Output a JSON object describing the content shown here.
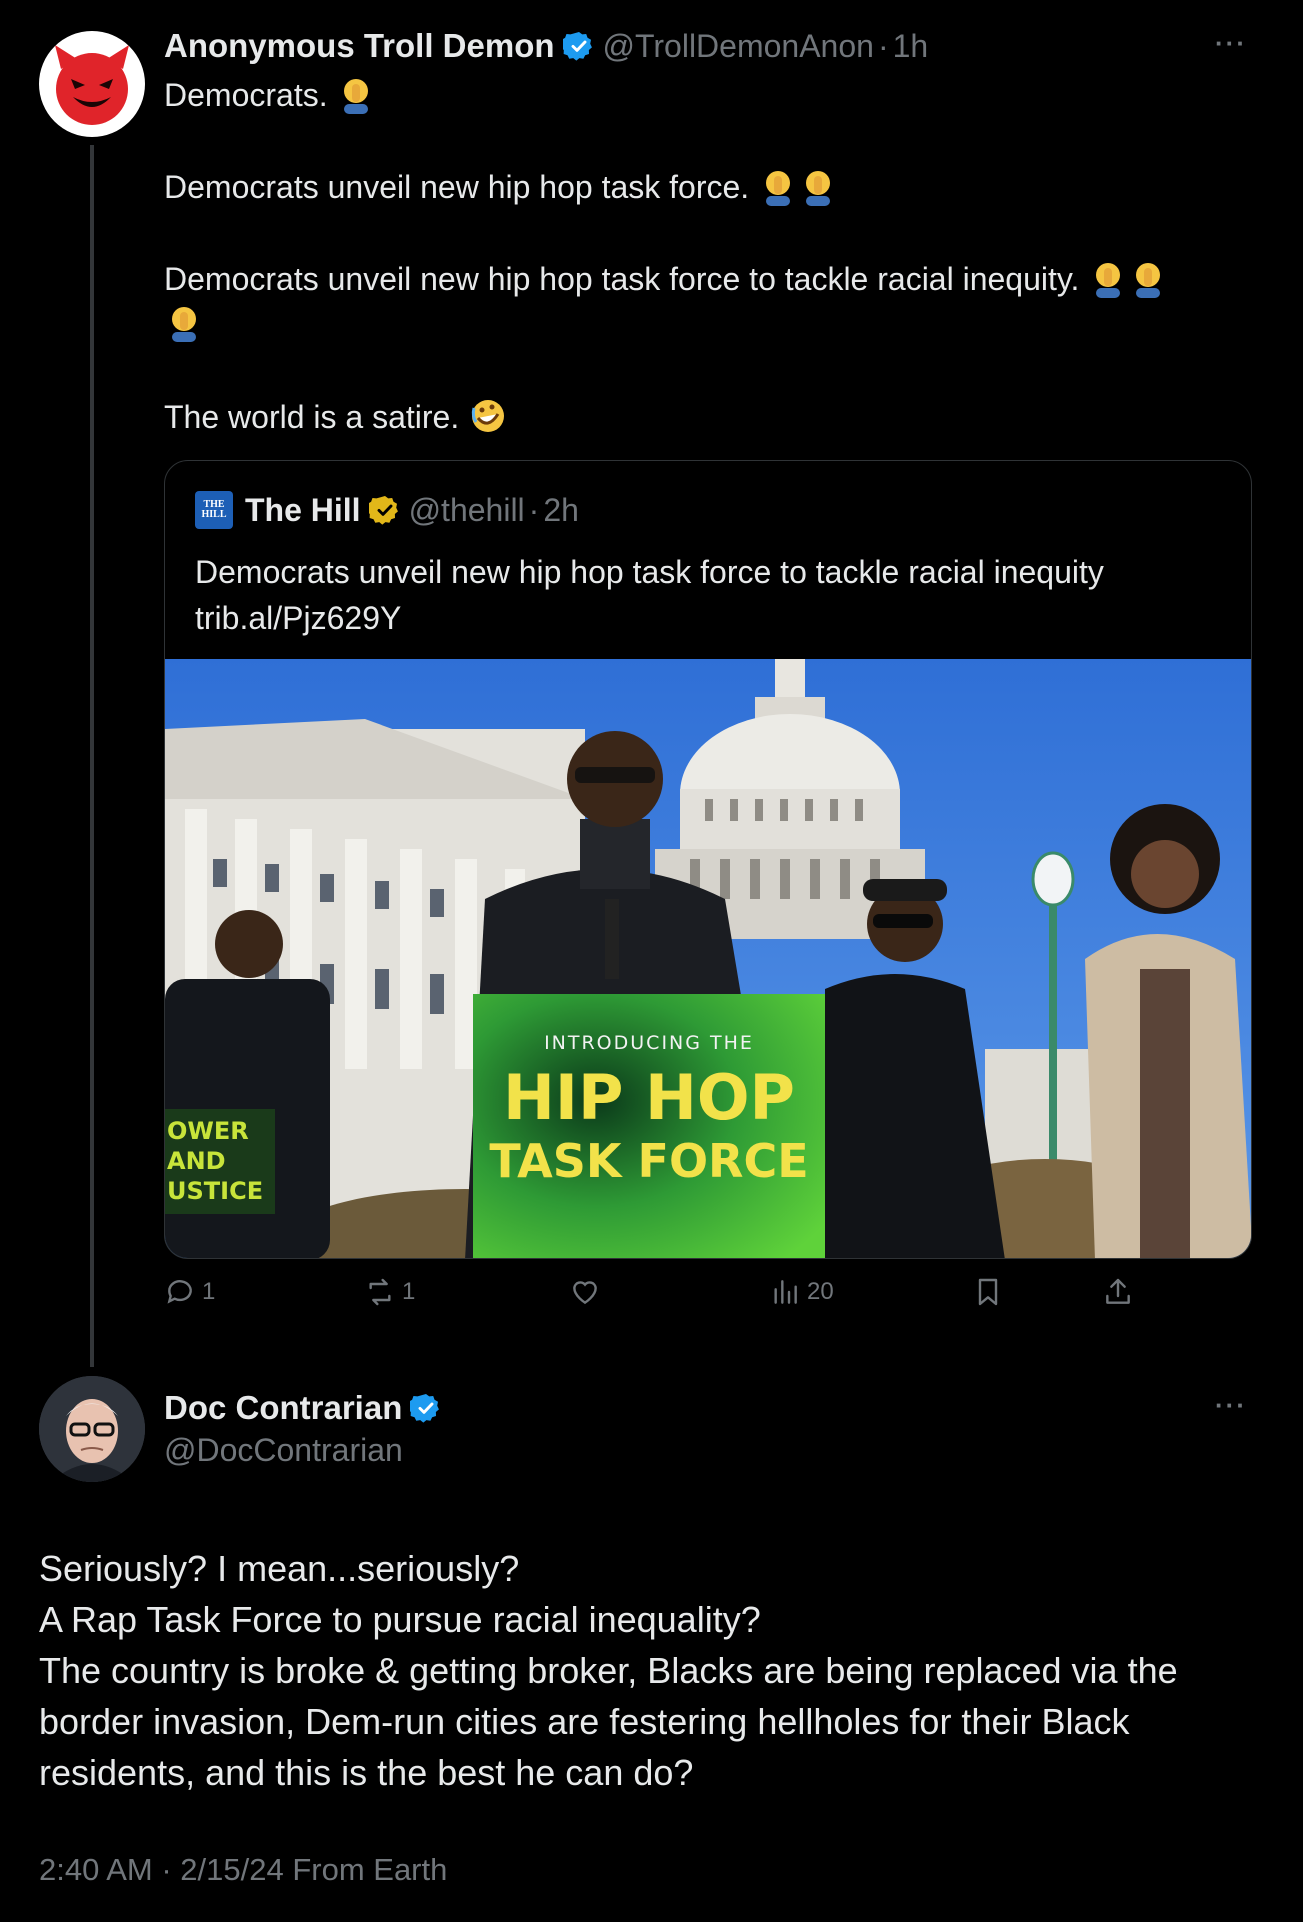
{
  "original_tweet": {
    "author_name": "Anonymous Troll Demon",
    "handle": "@TrollDemonAnon",
    "separator": "·",
    "time": "1h",
    "avatar_icon": "smiling-devil-icon",
    "lines": [
      "Democrats.",
      "Democrats unveil new hip hop task force.",
      "Democrats unveil new hip hop task force to tackle racial inequity.",
      "The world is a satire."
    ],
    "emojis": [
      "man-facepalming-emoji",
      "rolling-on-floor-laughing-emoji"
    ]
  },
  "quoted_tweet": {
    "author_name": "The Hill",
    "handle": "@thehill",
    "separator": "·",
    "time": "2h",
    "logo_text_top": "THE",
    "logo_text_bottom": "HILL",
    "text_line1": "Democrats unveil new hip hop task force to tackle racial inequity",
    "text_line2": "trib.al/Pjz629Y",
    "image": {
      "podium_top": "INTRODUCING THE",
      "podium_main1": "HIP HOP",
      "podium_main2": "TASK FORCE",
      "sign_line1": "OWER",
      "sign_line2": "AND",
      "sign_line3": "USTICE"
    }
  },
  "actions": {
    "replies": "1",
    "reposts": "1",
    "likes": "",
    "views": "20"
  },
  "reply_tweet": {
    "author_name": "Doc Contrarian",
    "handle": "@DocContrarian",
    "lines": [
      "Seriously? I mean...seriously?",
      "A Rap Task Force to pursue racial inequality?",
      "The country is broke & getting broker, Blacks are being replaced via the",
      "border invasion, Dem-run cities are festering hellholes for their Black",
      "residents, and this is the best he can do?"
    ],
    "timestamp": "2:40 AM · 2/15/24 From Earth"
  },
  "colors": {
    "background": "#000000",
    "text": "#e7e9ea",
    "muted": "#71767b",
    "verified_blue": "#1d9bf0",
    "verified_gold": "#e2b719",
    "border": "#2f3336"
  },
  "more_label": "···"
}
